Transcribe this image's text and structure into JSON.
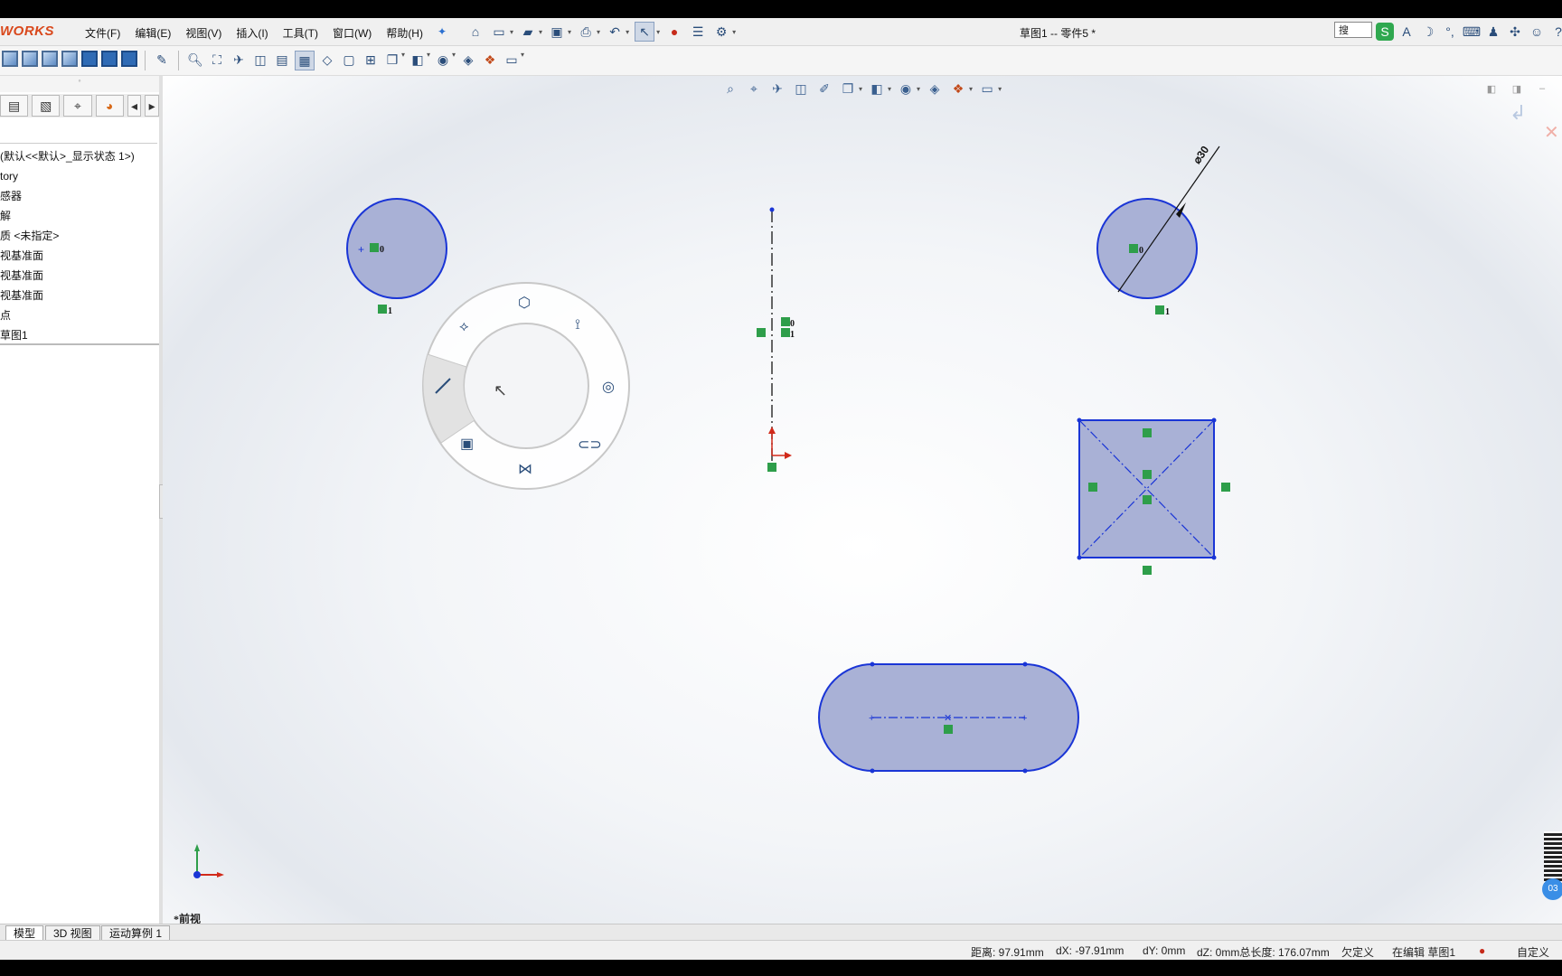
{
  "app": {
    "brand": "WORKS",
    "doc_title": "草图1 -- 零件5 *",
    "search_placeholder": "搜"
  },
  "menu": [
    "文件(F)",
    "编辑(E)",
    "视图(V)",
    "插入(I)",
    "工具(T)",
    "窗口(W)",
    "帮助(H)"
  ],
  "sidebar": {
    "tree": [
      "(默认<<默认>_显示状态 1>)",
      "tory",
      "感器",
      "解",
      "质 <未指定>",
      "视基准面",
      "视基准面",
      "视基准面",
      "点",
      "草图1"
    ]
  },
  "viewport": {
    "view_label": "*前视",
    "dimension_text": "⌀30",
    "relation_labels": {
      "zero": "0",
      "one": "1"
    }
  },
  "bottom_tabs": [
    "模型",
    "3D 视图",
    "运动算例 1"
  ],
  "status": {
    "distance": "距离: 97.91mm",
    "dx": "dX: -97.91mm",
    "dy": "dY: 0mm",
    "dz_total": "dZ: 0mm总长度: 176.07mm",
    "state": "欠定义",
    "editing": "在编辑 草图1",
    "custom": "自定义"
  },
  "overlay": {
    "badge": "03"
  },
  "colors": {
    "sketch_blue": "#1a35d6",
    "fill": "#a9b1d6",
    "relation_green": "#2e9e4a",
    "origin_red": "#d12a1a",
    "brand": "#d9481c"
  }
}
